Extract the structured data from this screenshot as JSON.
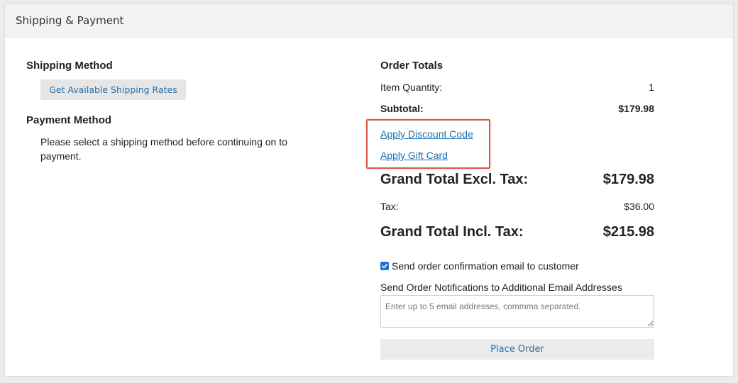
{
  "panel": {
    "title": "Shipping & Payment"
  },
  "shipping": {
    "title": "Shipping Method",
    "rates_button": "Get Available Shipping Rates"
  },
  "payment": {
    "title": "Payment Method",
    "message": "Please select a shipping method before continuing on to payment."
  },
  "totals": {
    "title": "Order Totals",
    "item_quantity_label": "Item Quantity:",
    "item_quantity_value": "1",
    "subtotal_label": "Subtotal:",
    "subtotal_value": "$179.98",
    "discount_link": "Apply Discount Code",
    "gift_card_link": "Apply Gift Card",
    "grand_excl_label": "Grand Total Excl. Tax:",
    "grand_excl_value": "$179.98",
    "tax_label": "Tax:",
    "tax_value": "$36.00",
    "grand_incl_label": "Grand Total Incl. Tax:",
    "grand_incl_value": "$215.98"
  },
  "notifications": {
    "confirm_checked": true,
    "confirm_label": "Send order confirmation email to customer",
    "additional_label": "Send Order Notifications to Additional Email Addresses",
    "email_value": "",
    "email_placeholder": "Enter up to 5 email addresses, commma separated."
  },
  "actions": {
    "place_order": "Place Order"
  },
  "colors": {
    "link": "#1a6fb0",
    "button_text": "#2a6fa8",
    "highlight_border": "#e0554a",
    "checkbox": "#1a73d9"
  },
  "icons": {
    "checkbox": "checkmark-icon"
  }
}
